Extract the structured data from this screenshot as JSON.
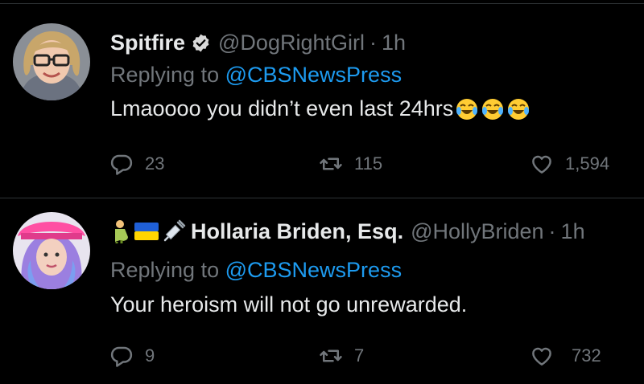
{
  "tweets": [
    {
      "display_name": "Spitfire",
      "handle": "@DogRightGirl",
      "separator": "·",
      "time": "1h",
      "reply_prefix": "Replying to",
      "reply_to": "@CBSNewsPress",
      "text": "Lmaoooo you didn’t even last 24hrs",
      "emojis": [
        "face-with-tears-of-joy",
        "face-with-tears-of-joy",
        "face-with-tears-of-joy"
      ],
      "replies": "23",
      "retweets": "115",
      "likes": "1,594",
      "verified": true
    },
    {
      "display_name": "Hollaria Briden, Esq.",
      "name_emojis": [
        "pregnant-man",
        "ukraine-flag",
        "syringe"
      ],
      "handle": "@HollyBriden",
      "separator": "·",
      "time": "1h",
      "reply_prefix": "Replying to",
      "reply_to": "@CBSNewsPress",
      "text": "Your heroism will not go unrewarded.",
      "replies": "9",
      "retweets": "7",
      "likes": "732"
    }
  ],
  "colors": {
    "background": "#000000",
    "primary_text": "#e7e9ea",
    "secondary_text": "#71767b",
    "link": "#1d9bf0",
    "divider": "#2f3336"
  }
}
